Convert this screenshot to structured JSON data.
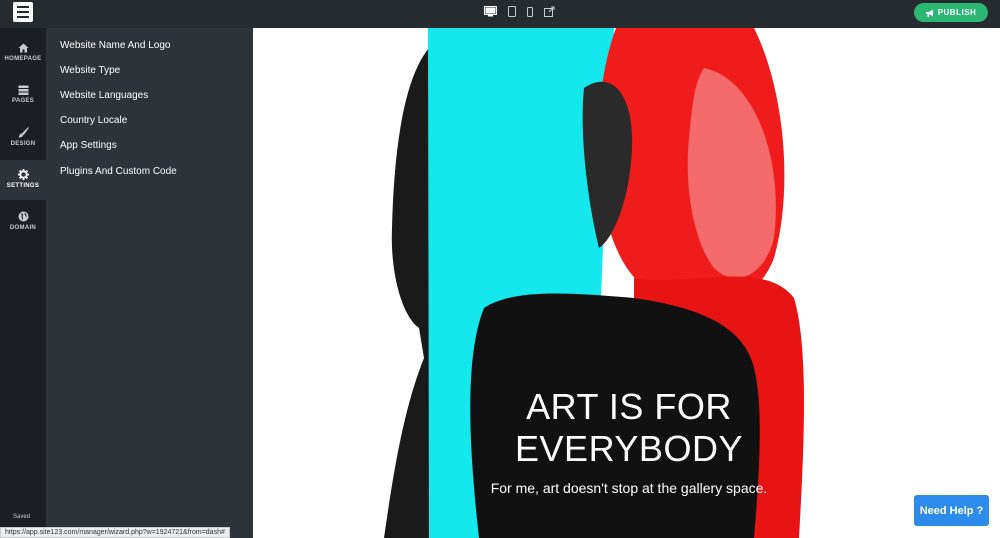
{
  "topbar": {
    "logo_icon": "menu-logo-icon",
    "device_icons": [
      "desktop-icon",
      "tablet-icon",
      "mobile-icon",
      "external-link-icon"
    ],
    "publish_label": "PUBLISH",
    "publish_icon": "megaphone-icon",
    "accent_color": "#2bb673"
  },
  "rail": {
    "items": [
      {
        "label": "HOMEPAGE",
        "icon": "home-icon"
      },
      {
        "label": "PAGES",
        "icon": "pages-icon"
      },
      {
        "label": "DESIGN",
        "icon": "brush-icon"
      },
      {
        "label": "SETTINGS",
        "icon": "gear-icon",
        "active": true
      },
      {
        "label": "DOMAIN",
        "icon": "globe-icon"
      }
    ],
    "saved_text": "Saved"
  },
  "settings_menu": {
    "items": [
      "Website Name And Logo",
      "Website Type",
      "Website Languages",
      "Country Locale",
      "App Settings",
      "Plugins And Custom Code"
    ]
  },
  "preview": {
    "hero_title_line1": "ART IS FOR",
    "hero_title_line2": "EVERYBODY",
    "hero_subtitle": "For me, art doesn't stop at the gallery space.",
    "colors": {
      "cyan": "#14e8ec",
      "red": "#f01c1c",
      "dark": "#111111"
    }
  },
  "help_button": {
    "label": "Need Help ?",
    "color": "#2d8ceb"
  },
  "status_bar": {
    "url": "https://app.site123.com/manager/wizard.php?w=1924721&from=dash#"
  }
}
